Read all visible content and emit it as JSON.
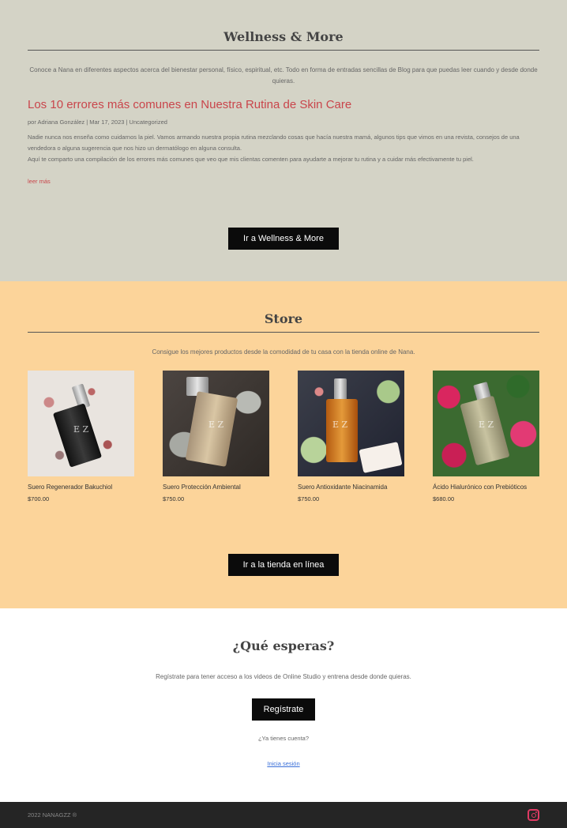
{
  "wellness": {
    "title": "Wellness & More",
    "description": "Conoce a Nana en diferentes aspectos acerca del bienestar personal, físico, espiritual, etc. Todo en forma de entradas sencillas de Blog para que puedas leer cuando y desde donde quieras.",
    "post": {
      "title": "Los 10 errores más comunes en Nuestra Rutina de Skin Care",
      "meta": "por Adriana González | Mar 17, 2023 | Uncategorized",
      "body1": "Nadie nunca nos enseña como cuidarnos la piel. Vamos armando nuestra propia rutina mezclando cosas que hacía nuestra mamá, algunos tips que vimos en una revista, consejos de una vendedora o alguna sugerencia que nos hizo un dermatólogo en alguna consulta.",
      "body2": "Aquí te comparto una compilación de los errores más comunes que veo que mis clientas comenten para ayudarte a mejorar tu rutina y a cuidar más efectivamente tu piel.",
      "more": "leer más"
    },
    "button": "Ir a Wellness & More"
  },
  "store": {
    "title": "Store",
    "description": "Consigue los mejores productos desde la comodidad de tu casa con la tienda online de Nana.",
    "products": [
      {
        "name": "Suero Regenerador Bakuchiol",
        "price": "$700.00"
      },
      {
        "name": "Suero Protección Ambiental",
        "price": "$750.00"
      },
      {
        "name": "Suero Antioxidante Niacinamida",
        "price": "$750.00"
      },
      {
        "name": "Ácido Hialurónico con Prebióticos",
        "price": "$680.00"
      }
    ],
    "button": "Ir a la tienda en línea"
  },
  "cta": {
    "title": "¿Qué esperas?",
    "description": "Regístrate para tener acceso a los videos de Online Studio y entrena desde donde quieras.",
    "button": "Regístrate",
    "question": "¿Ya tienes cuenta?",
    "login": "Inicia sesión"
  },
  "footer": {
    "copyright": "2022 NANAGZZ ®",
    "social_icon": "instagram-icon"
  },
  "colors": {
    "wellness_bg": "#d4d3c6",
    "store_bg": "#fcd49a",
    "accent": "#c9454b",
    "footer_bg": "#252525"
  }
}
